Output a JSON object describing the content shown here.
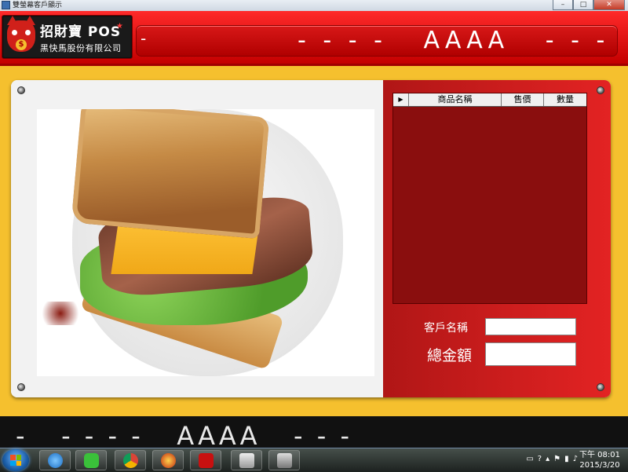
{
  "window": {
    "title": "雙螢幕客戶顯示",
    "controls": [
      "–",
      "□",
      "✕"
    ]
  },
  "header": {
    "logo_brand": "招財寶 POS",
    "logo_company": "黑快馬股份有限公司",
    "logo_star": "★",
    "logo_coin": "$",
    "marquee_dash": "-",
    "marquee_text": "- - - -   AAAA   - - -"
  },
  "grid": {
    "selector": "▶",
    "columns": [
      "商品名稱",
      "售價",
      "數量"
    ]
  },
  "customer": {
    "name_label": "客戶名稱",
    "name_value": "",
    "total_label": "總金額",
    "total_value": ""
  },
  "bottom_banner": {
    "text": "-   - - - -   AAAA   - - -"
  },
  "taskbar": {
    "apps": [
      "start-icon",
      "ie-icon",
      "line-icon",
      "chrome-icon",
      "fortune-icon",
      "pos-icon",
      "printer-icon",
      "usb-icon"
    ],
    "clock_time": "下午 08:01",
    "clock_date": "2015/3/20"
  },
  "colors": {
    "banner_red": "#e01010",
    "panel_dark_red": "#8a0e0e",
    "background_yellow": "#f5c02e"
  }
}
